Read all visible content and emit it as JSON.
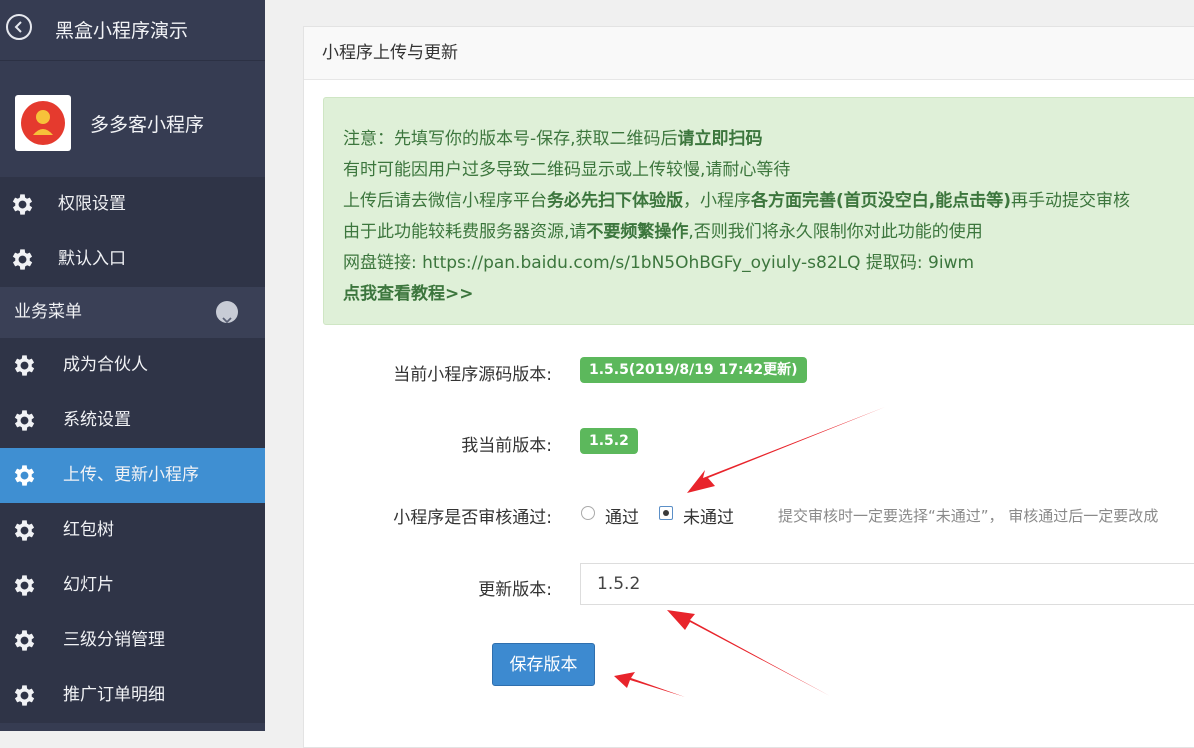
{
  "app": {
    "title": "黑盒小程序演示"
  },
  "shop": {
    "name": "多多客小程序"
  },
  "sidebar": {
    "top_items": [
      {
        "label": "权限设置"
      },
      {
        "label": "默认入口"
      }
    ],
    "group_label": "业务菜单",
    "sub_items": [
      {
        "label": "成为合伙人"
      },
      {
        "label": "系统设置"
      },
      {
        "label": "上传、更新小程序"
      },
      {
        "label": "红包树"
      },
      {
        "label": "幻灯片"
      },
      {
        "label": "三级分销管理"
      },
      {
        "label": "推广订单明细"
      }
    ]
  },
  "panel": {
    "title": "小程序上传与更新"
  },
  "notice": {
    "l1_a": "注意：先填写你的版本号-保存,获取二维码后",
    "l1_b": "请立即扫码",
    "l2": "有时可能因用户过多导致二维码显示或上传较慢,请耐心等待",
    "l3_a": "上传后请去微信小程序平台",
    "l3_b": "务必先扫下体验版",
    "l3_c": "，小程序",
    "l3_d": "各方面完善(首页没空白,能点击等)",
    "l3_e": "再手动提交审核",
    "l4_a": "由于此功能较耗费服务器资源,请",
    "l4_b": "不要频繁操作",
    "l4_c": ",否则我们将永久限制你对此功能的使用",
    "l5": "网盘链接: https://pan.baidu.com/s/1bN5OhBGFy_oyiuly-s82LQ 提取码: 9iwm",
    "l6": "点我查看教程>>"
  },
  "form": {
    "source_label": "当前小程序源码版本:",
    "source_version": "1.5.5(2019/8/19 17:42更新)",
    "my_label": "我当前版本:",
    "my_version": "1.5.2",
    "audit_label": "小程序是否审核通过:",
    "audit_pass": "通过",
    "audit_fail": "未通过",
    "audit_selected": "未通过",
    "audit_hint": "提交审核时一定要选择“未通过”， 审核通过后一定要改成",
    "update_label": "更新版本:",
    "update_value": "1.5.2",
    "save_label": "保存版本"
  },
  "colors": {
    "sidebar_bg": "#2f3447",
    "sidebar_active": "#3f8fd2",
    "notice_bg": "#dff0d8",
    "notice_text": "#3c763d",
    "badge_green": "#5cb85c",
    "button_blue": "#3d8ad0",
    "arrow_red": "#e8242b"
  },
  "icons": {
    "back": "chevron-left-circle-icon",
    "menu": "gear-icon",
    "group": "chevron-down-icon"
  }
}
